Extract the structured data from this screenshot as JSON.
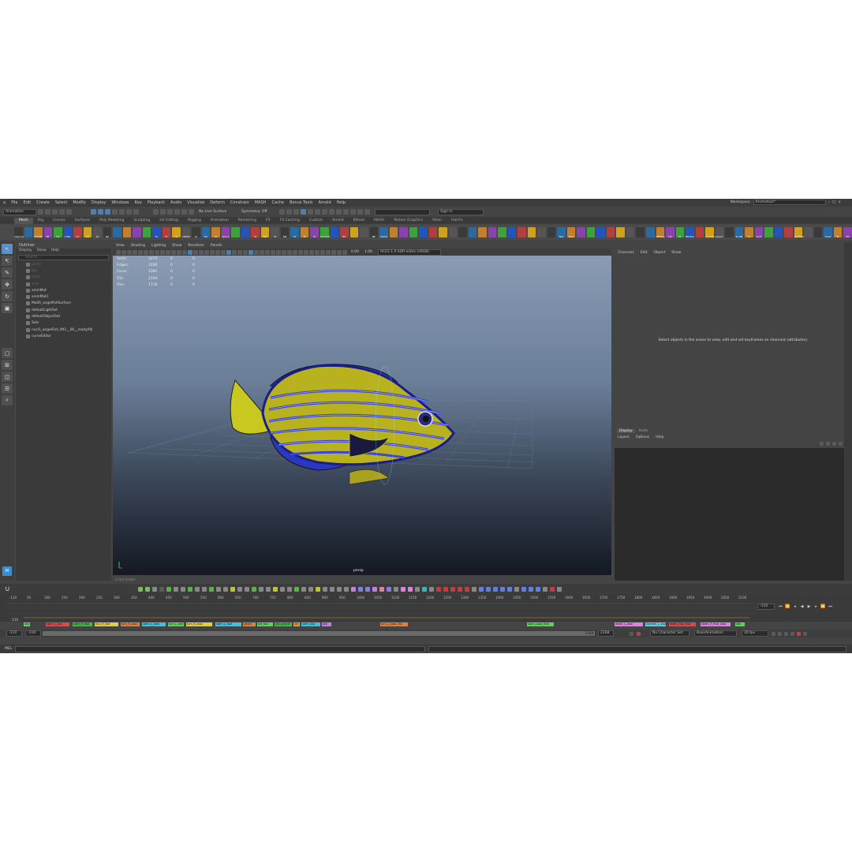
{
  "menubar": {
    "items": [
      "File",
      "Edit",
      "Create",
      "Select",
      "Modify",
      "Display",
      "Windows",
      "Key",
      "Playback",
      "Audio",
      "Visualize",
      "Deform",
      "Constrain",
      "MASH",
      "Cache",
      "Bonus Tools",
      "Arnold",
      "Help"
    ],
    "workspace_label": "Workspace:",
    "workspace_value": "Animation*"
  },
  "statusline": {
    "menu_set": "Animation",
    "live_surface": "No Live Surface",
    "symmetry": "Symmetry: Off",
    "sign_in": "Sign In"
  },
  "shelf": {
    "tabs": [
      "Mesh",
      "Rig",
      "Curves",
      "Surfaces",
      "Poly Modeling",
      "Sculpting",
      "UV Editing",
      "Rigging",
      "Animation",
      "Rendering",
      "FX",
      "FX Caching",
      "Custom",
      "Arnold",
      "Bifrost",
      "MASH",
      "Motion Graphics",
      "XGen",
      "HairFx"
    ],
    "active_tab": 0,
    "buttons": [
      "channel",
      "",
      "CLEAN",
      "BT",
      "CP",
      "CTRL",
      "CV",
      "CV",
      "JO",
      "IKs",
      "",
      "",
      "",
      "",
      "M",
      "Ft",
      "R",
      "CONST",
      "M",
      "DC",
      "M",
      "Space",
      "",
      "",
      "M",
      "MT",
      "M",
      "MR",
      "M",
      "M",
      "M",
      "Connect",
      "",
      "BS",
      "",
      "",
      "BE",
      "CpDat",
      "",
      "",
      "",
      "",
      "",
      "",
      "",
      "",
      "",
      "",
      "",
      "",
      "",
      "",
      "",
      "",
      "",
      "Bez",
      "Gtex",
      "",
      "",
      "",
      "",
      "",
      "",
      "",
      "",
      "OBrKey",
      "Init",
      "M",
      "Bfollow",
      "",
      "co_dupl",
      "export",
      "",
      "B_CNJ",
      "M",
      "B_M",
      "",
      "",
      "",
      "DyChain",
      "",
      "",
      "Crew",
      "M",
      "ES"
    ],
    "colors": [
      "#3a3a3a",
      "#2a6aa0",
      "#c08030",
      "#8844aa",
      "#3fa040",
      "#2255bb",
      "#b04040",
      "#d0a020",
      "#555"
    ]
  },
  "outliner": {
    "title": "Outliner",
    "menu": [
      "Display",
      "Show",
      "Help"
    ],
    "search_placeholder": "Search...",
    "items": [
      {
        "label": "persp",
        "dim": true
      },
      {
        "label": "top",
        "dim": true
      },
      {
        "label": "front",
        "dim": true
      },
      {
        "label": "side",
        "dim": true
      },
      {
        "label": "animMat",
        "dim": false
      },
      {
        "label": "animMat1",
        "dim": false
      },
      {
        "label": "Ma06_angelfishSurface",
        "dim": false
      },
      {
        "label": "defaultLightSet",
        "dim": false
      },
      {
        "label": "defaultObjectSet",
        "dim": false
      },
      {
        "label": "Sets",
        "dim": false
      },
      {
        "label": "nucl1_angelFish_Mt1__06__readyAN",
        "dim": false
      },
      {
        "label": "curveEditor",
        "dim": false
      }
    ]
  },
  "viewport": {
    "menu": [
      "View",
      "Shading",
      "Lighting",
      "Show",
      "Renderer",
      "Panels"
    ],
    "gamma_a": "0.00",
    "gamma_b": "1.00",
    "color_space": "ACES 1.0 SDR-video (sRGB)",
    "camera": "persp",
    "hud": [
      {
        "label": "Verts:",
        "a": "1879",
        "b": "0",
        "c": "0"
      },
      {
        "label": "Edges:",
        "a": "3180",
        "b": "0",
        "c": "0"
      },
      {
        "label": "Faces:",
        "a": "1082",
        "b": "0",
        "c": "0"
      },
      {
        "label": "Tris:",
        "a": "2104",
        "b": "0",
        "c": "0"
      },
      {
        "label": "UVs:",
        "a": "1716",
        "b": "0",
        "c": "0"
      }
    ],
    "fish_colors": {
      "body": "#b8b21f",
      "stripe": "#3a44e0",
      "edge": "#1a1e8a"
    }
  },
  "channel_box": {
    "menu": [
      "Channels",
      "Edit",
      "Object",
      "Show"
    ],
    "message": "Select objects in the scene to view, edit and set keyframes on channels (attributes)."
  },
  "layer_editor": {
    "tabs": [
      "Display",
      "Anim"
    ],
    "menu": [
      "Layers",
      "Options",
      "Help"
    ]
  },
  "graph_label": "Graph Editor",
  "timeslider": {
    "ticks": [
      "-110",
      "50",
      "100",
      "150",
      "200",
      "250",
      "300",
      "350",
      "400",
      "450",
      "500",
      "550",
      "600",
      "650",
      "700",
      "750",
      "800",
      "850",
      "900",
      "950",
      "1000",
      "1050",
      "1100",
      "1150",
      "1200",
      "1250",
      "1300",
      "1350",
      "1400",
      "1450",
      "1500",
      "1550",
      "1600",
      "1650",
      "1700",
      "1750",
      "1800",
      "1850",
      "1900",
      "1950",
      "2000",
      "2050",
      "2100"
    ],
    "current_frame": "-110",
    "clip_label_start": "-110",
    "clips": [
      {
        "label": "idle",
        "color": "#5cd35c"
      },
      {
        "label": "swim_L_fwd",
        "color": "#e04848"
      },
      {
        "label": "swim_R_fwd",
        "color": "#44b844"
      },
      {
        "label": "turn_R_fast",
        "color": "#e0d040"
      },
      {
        "label": "turn_R_slow",
        "color": "#e08040"
      },
      {
        "label": "swim_L_slow",
        "color": "#40c0e0"
      },
      {
        "label": "turn_L_fast",
        "color": "#5cd35c"
      },
      {
        "label": "turn_R_slow",
        "color": "#e0d040"
      },
      {
        "label": "swim_L_fast",
        "color": "#40c0e0"
      },
      {
        "label": "attack",
        "color": "#e08040"
      },
      {
        "label": "eat_fast",
        "color": "#5cd35c"
      },
      {
        "label": "eat_ground",
        "color": "#44b844"
      },
      {
        "label": "eat",
        "color": "#e0a040"
      },
      {
        "label": "swim_fast",
        "color": "#40c0e0"
      },
      {
        "label": "idle",
        "color": "#c080e0"
      },
      {
        "label": "turn_L_slow_30s",
        "color": "#e08040"
      },
      {
        "label": "swim_Loop_final",
        "color": "#5cd35c"
      },
      {
        "label": "death_L_slow",
        "color": "#e080e0"
      },
      {
        "label": "Startled_L_slow_final",
        "color": "#60d0e0"
      },
      {
        "label": "death_Fast_final",
        "color": "#e04848"
      },
      {
        "label": "death_R_final_slow",
        "color": "#e080e0"
      },
      {
        "label": "idle",
        "color": "#5cd35c"
      }
    ]
  },
  "range": {
    "start": "-110",
    "inner_start": "-110",
    "inner_end": "2168",
    "end": "2168",
    "character_set": "No Character Set",
    "anim_layer": "BaseAnimation",
    "fps": "30 fps"
  },
  "cmd": {
    "lang": "MEL"
  }
}
